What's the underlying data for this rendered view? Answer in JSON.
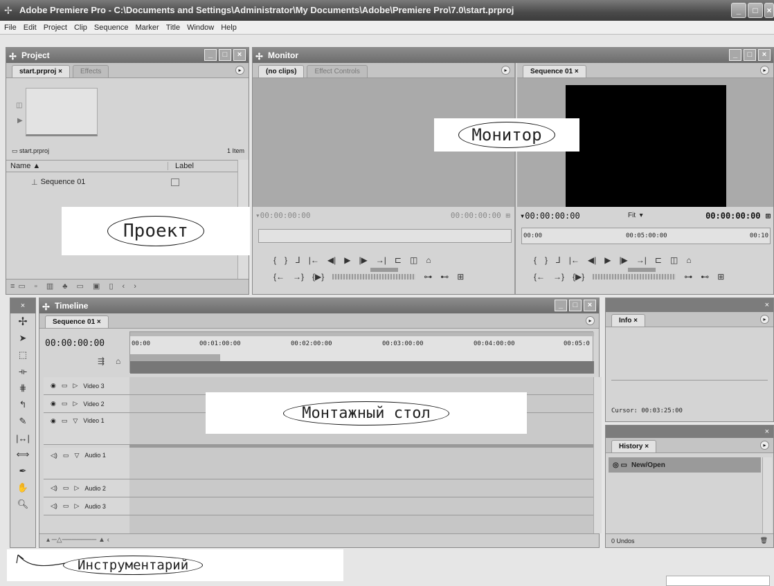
{
  "window": {
    "title": "Adobe Premiere Pro - C:\\Documents and Settings\\Administrator\\My Documents\\Adobe\\Premiere Pro\\7.0\\start.prproj"
  },
  "menu": [
    "File",
    "Edit",
    "Project",
    "Clip",
    "Sequence",
    "Marker",
    "Title",
    "Window",
    "Help"
  ],
  "project": {
    "title": "Project",
    "tabs": [
      "start.prproj ×",
      "Effects"
    ],
    "file_name": "start.prproj",
    "item_count": "1 Item",
    "columns": [
      "Name",
      "Label"
    ],
    "items": [
      "Sequence 01"
    ],
    "annotation": "Проект"
  },
  "monitor": {
    "title": "Monitor",
    "source_tabs": [
      "(no clips)",
      "Effect Controls"
    ],
    "program_tab": "Sequence 01 ×",
    "source_tc_left": "00:00:00:00",
    "source_tc_right": "00:00:00:00",
    "program_tc_left": "00:00:00:00",
    "program_fit": "Fit",
    "program_tc_right": "00:00:00:00",
    "ruler_start": "00:00",
    "ruler_mid": "00:05:00:00",
    "ruler_end": "00:10",
    "annotation": "Монитор"
  },
  "timeline": {
    "title": "Timeline",
    "tab": "Sequence 01 ×",
    "timecode": "00:00:00:00",
    "ruler": [
      "00:00",
      "00:01:00:00",
      "00:02:00:00",
      "00:03:00:00",
      "00:04:00:00",
      "00:05:0"
    ],
    "tracks": [
      "Video 3",
      "Video 2",
      "Video 1",
      "Audio 1",
      "Audio 2",
      "Audio 3"
    ],
    "annotation": "Монтажный стол"
  },
  "info": {
    "tab": "Info ×",
    "cursor": "Cursor: 00:03:25:00"
  },
  "history": {
    "tab": "History ×",
    "entry": "New/Open",
    "undos": "0 Undos"
  },
  "tools": {
    "annotation": "Инструментарий",
    "icons": [
      "selection-tool-icon",
      "track-select-tool-icon",
      "ripple-edit-tool-icon",
      "rolling-edit-tool-icon",
      "rate-stretch-tool-icon",
      "razor-tool-icon",
      "slip-tool-icon",
      "slide-tool-icon",
      "pen-tool-icon",
      "hand-tool-icon",
      "zoom-tool-icon"
    ]
  }
}
